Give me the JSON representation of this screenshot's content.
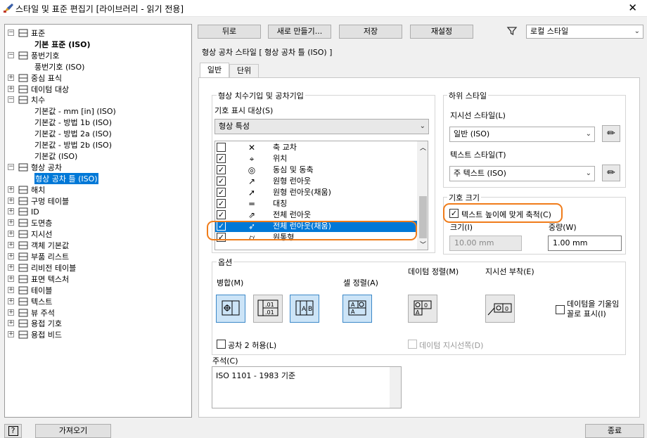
{
  "window": {
    "title": "스타일 및 표준 편집기 [라이브러리 - 읽기 전용]",
    "close_glyph": "✕"
  },
  "tree": [
    {
      "label": "표준",
      "depth": 0,
      "expander": "−",
      "icon": "standard-icon"
    },
    {
      "label": "기본 표준 (ISO)",
      "depth": 1,
      "bold": true
    },
    {
      "label": "풍번기호",
      "depth": 0,
      "expander": "−",
      "icon": "balloon-icon"
    },
    {
      "label": "풍번기호 (ISO)",
      "depth": 1
    },
    {
      "label": "중심 표식",
      "depth": 0,
      "expander": "+",
      "icon": "center-mark-icon"
    },
    {
      "label": "데이텀 대상",
      "depth": 0,
      "expander": "+",
      "icon": "datum-target-icon"
    },
    {
      "label": "치수",
      "depth": 0,
      "expander": "−",
      "icon": "dimension-icon"
    },
    {
      "label": "기본값 - mm [in] (ISO)",
      "depth": 1
    },
    {
      "label": "기본값 - 방법 1b (ISO)",
      "depth": 1
    },
    {
      "label": "기본값 - 방법 2a (ISO)",
      "depth": 1
    },
    {
      "label": "기본값 - 방법 2b (ISO)",
      "depth": 1
    },
    {
      "label": "기본값 (ISO)",
      "depth": 1
    },
    {
      "label": "형상 공차",
      "depth": 0,
      "expander": "−",
      "icon": "feature-control-frame-icon"
    },
    {
      "label": "형상 공차 틀 (ISO)",
      "depth": 1,
      "selected": true
    },
    {
      "label": "해치",
      "depth": 0,
      "expander": "+",
      "icon": "hatch-icon"
    },
    {
      "label": "구멍 테이블",
      "depth": 0,
      "expander": "+",
      "icon": "hole-table-icon"
    },
    {
      "label": "ID",
      "depth": 0,
      "expander": "+",
      "icon": "id-icon"
    },
    {
      "label": "도면층",
      "depth": 0,
      "expander": "+",
      "icon": "layers-icon"
    },
    {
      "label": "지시선",
      "depth": 0,
      "expander": "+",
      "icon": "leader-icon"
    },
    {
      "label": "객체 기본값",
      "depth": 0,
      "expander": "+",
      "icon": "object-defaults-icon"
    },
    {
      "label": "부품 리스트",
      "depth": 0,
      "expander": "+",
      "icon": "parts-list-icon"
    },
    {
      "label": "리비전 테이블",
      "depth": 0,
      "expander": "+",
      "icon": "revision-table-icon"
    },
    {
      "label": "표면 텍스처",
      "depth": 0,
      "expander": "+",
      "icon": "surface-texture-icon"
    },
    {
      "label": "테이블",
      "depth": 0,
      "expander": "+",
      "icon": "table-icon"
    },
    {
      "label": "텍스트",
      "depth": 0,
      "expander": "+",
      "icon": "text-icon"
    },
    {
      "label": "뷰 주석",
      "depth": 0,
      "expander": "+",
      "icon": "view-annotation-icon"
    },
    {
      "label": "용접 기호",
      "depth": 0,
      "expander": "+",
      "icon": "weld-symbol-icon"
    },
    {
      "label": "용접 비드",
      "depth": 0,
      "expander": "+",
      "icon": "weld-bead-icon"
    }
  ],
  "toolbar": {
    "back": "뒤로",
    "new": "새로 만들기...",
    "save": "저장",
    "reset": "재설정",
    "filter": "로컬 스타일"
  },
  "panel": {
    "title": "형상 공차 스타일 [ 형상 공차 틀 (ISO) ]"
  },
  "tabs": [
    "일반",
    "단위"
  ],
  "fcf_group": {
    "title": "형상 치수기입 및 공차기입",
    "display_label": "기호 표시 대상(S)",
    "display_value": "형상 특성",
    "items": [
      {
        "checked": false,
        "symbol": "✕",
        "label": "축 교차"
      },
      {
        "checked": true,
        "symbol": "⌖",
        "label": "위치"
      },
      {
        "checked": true,
        "symbol": "◎",
        "label": "동심 및 동축"
      },
      {
        "checked": true,
        "symbol": "↗",
        "label": "원형 런아웃"
      },
      {
        "checked": true,
        "symbol": "➚",
        "label": "원형 런아웃(채움)"
      },
      {
        "checked": true,
        "symbol": "═",
        "label": "대칭"
      },
      {
        "checked": true,
        "symbol": "⇗",
        "label": "전체 런아웃"
      },
      {
        "checked": true,
        "symbol": "➶",
        "label": "전체 런아웃(채움)",
        "selected": true
      },
      {
        "checked": true,
        "symbol": "⌭",
        "label": "원통형"
      }
    ]
  },
  "substyle": {
    "title": "하위 스타일",
    "leader_label": "지시선 스타일(L)",
    "leader_value": "일반 (ISO)",
    "text_label": "텍스트 스타일(T)",
    "text_value": "주 텍스트 (ISO)"
  },
  "symbol_size": {
    "title": "기호 크기",
    "scale_label": "텍스트 높이에 맞게 축척(C)",
    "scale_checked": true,
    "size_label": "크기(I)",
    "size_value": "10.00 mm",
    "weight_label": "중량(W)",
    "weight_value": "1.00 mm"
  },
  "options": {
    "title": "옵션",
    "merge_label": "병합(M)",
    "cell_align_label": "셀 정렬(A)",
    "datum_align_label": "데이텀 정렬(M)",
    "leader_attach_label": "지시선 부착(E)",
    "datum_slanted_label": "데이텀을 기울임꼴로 표시(I)",
    "datum_slanted_checked": false,
    "tol2_label": "공차 2 허용(L)",
    "tol2_checked": false,
    "datum_leader_label": "데이텀 지시선쪽(D)",
    "datum_leader_checked": false
  },
  "notes": {
    "label": "주석(C)",
    "value": "ISO 1101 - 1983 기준"
  },
  "footer": {
    "import": "가져오기",
    "close": "종료",
    "help": "?"
  },
  "colors": {
    "accent": "#0078d7",
    "highlight": "#f07c1a"
  }
}
